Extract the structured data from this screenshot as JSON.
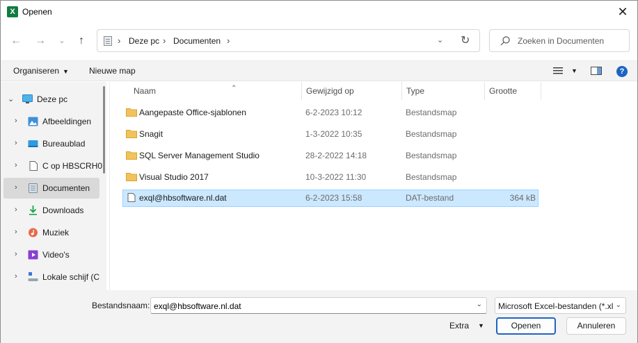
{
  "window": {
    "title": "Openen",
    "app_icon_letter": "X"
  },
  "nav": {
    "back": "←",
    "forward": "→",
    "recent": "⌄",
    "up": "↑",
    "breadcrumb": [
      "Deze pc",
      "Documenten"
    ],
    "search_placeholder": "Zoeken in Documenten"
  },
  "command_bar": {
    "organize": "Organiseren",
    "new_folder": "Nieuwe map"
  },
  "navpane": {
    "items": [
      {
        "label": "Deze pc",
        "icon": "monitor-icon",
        "expander": "⌄"
      },
      {
        "label": "Afbeeldingen",
        "icon": "pictures-icon",
        "expander": "›"
      },
      {
        "label": "Bureaublad",
        "icon": "desktop-icon",
        "expander": "›"
      },
      {
        "label": "C op HBSCRH0",
        "icon": "drive-icon",
        "expander": "›"
      },
      {
        "label": "Documenten",
        "icon": "documents-icon",
        "expander": "›"
      },
      {
        "label": "Downloads",
        "icon": "downloads-icon",
        "expander": "›"
      },
      {
        "label": "Muziek",
        "icon": "music-icon",
        "expander": "›"
      },
      {
        "label": "Video's",
        "icon": "videos-icon",
        "expander": "›"
      },
      {
        "label": "Lokale schijf (C",
        "icon": "local-disk-icon",
        "expander": "›"
      }
    ]
  },
  "columns": {
    "name": "Naam",
    "modified": "Gewijzigd op",
    "type": "Type",
    "size": "Grootte"
  },
  "files": [
    {
      "name": "Aangepaste Office-sjablonen",
      "modified": "6-2-2023 10:12",
      "type": "Bestandsmap",
      "size": ""
    },
    {
      "name": "Snagit",
      "modified": "1-3-2022 10:35",
      "type": "Bestandsmap",
      "size": ""
    },
    {
      "name": "SQL Server Management Studio",
      "modified": "28-2-2022 14:18",
      "type": "Bestandsmap",
      "size": ""
    },
    {
      "name": "Visual Studio 2017",
      "modified": "10-3-2022 11:30",
      "type": "Bestandsmap",
      "size": ""
    },
    {
      "name": "exql@hbsoftware.nl.dat",
      "modified": "6-2-2023 15:58",
      "type": "DAT-bestand",
      "size": "364 kB"
    }
  ],
  "bottom": {
    "filename_label": "Bestandsnaam:",
    "filename_value": "exql@hbsoftware.nl.dat",
    "filetype": "Microsoft Excel-bestanden (*.xl",
    "extra": "Extra",
    "open": "Openen",
    "cancel": "Annuleren"
  },
  "colors": {
    "accent": "#1e63c3",
    "selection": "#cce8ff",
    "folder": "#f2c35c",
    "excel": "#107c41"
  }
}
